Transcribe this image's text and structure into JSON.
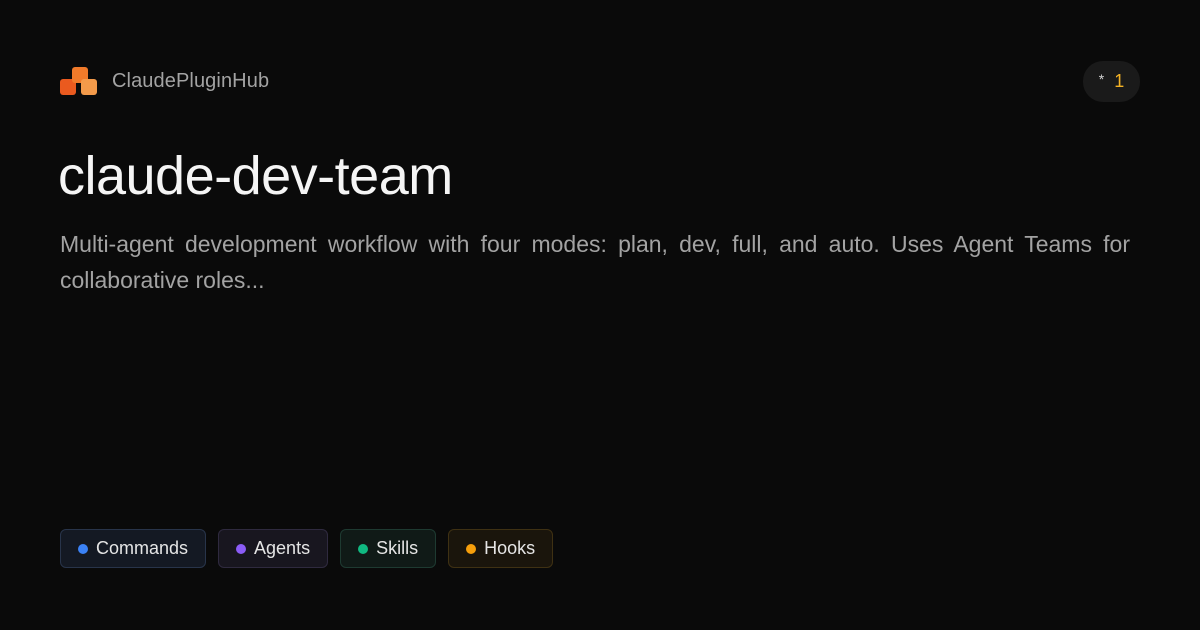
{
  "brand": {
    "name": "ClaudePluginHub"
  },
  "stars": {
    "icon": "*",
    "count": "1"
  },
  "plugin": {
    "title": "claude-dev-team",
    "description": "Multi-agent development workflow with four modes: plan, dev, full, and auto. Uses Agent Teams for collaborative roles..."
  },
  "tags": [
    {
      "label": "Commands",
      "color": "#3b82f6"
    },
    {
      "label": "Agents",
      "color": "#8b5cf6"
    },
    {
      "label": "Skills",
      "color": "#10b981"
    },
    {
      "label": "Hooks",
      "color": "#f59e0b"
    }
  ]
}
